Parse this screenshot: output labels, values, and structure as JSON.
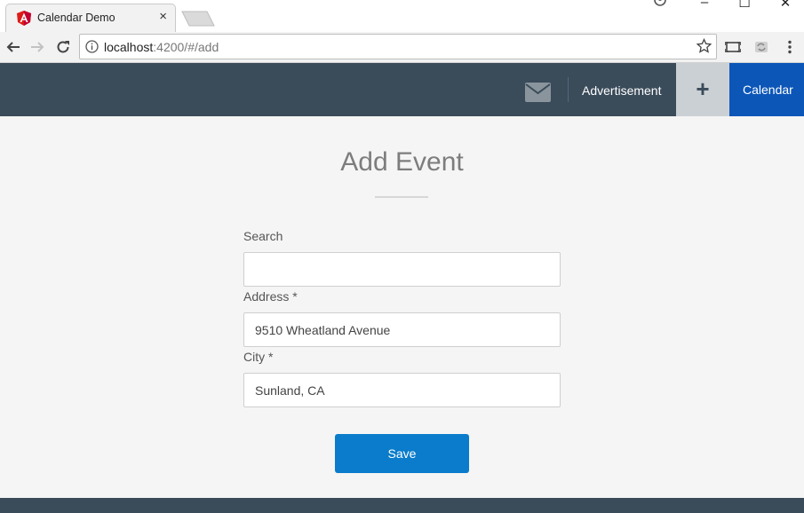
{
  "browser": {
    "tab_title": "Calendar Demo",
    "tab_close": "×",
    "url_host": "localhost",
    "url_rest": ":4200/#/add",
    "window_controls": {
      "minimize": "–",
      "maximize": "☐",
      "close": "✕"
    }
  },
  "header": {
    "advertisement_label": "Advertisement",
    "plus_label": "+",
    "calendar_label": "Calendar"
  },
  "form": {
    "title": "Add Event",
    "search": {
      "label": "Search",
      "value": ""
    },
    "address": {
      "label": "Address *",
      "value": "9510 Wheatland Avenue"
    },
    "city": {
      "label": "City *",
      "value": "Sunland, CA"
    },
    "save_label": "Save"
  },
  "colors": {
    "header_bg": "#3a4b5a",
    "calendar_btn": "#0c56b8",
    "save_btn": "#0a7ccb",
    "plus_btn": "#cbd0d4"
  },
  "icons": [
    "angular-icon",
    "back-arrow-icon",
    "forward-arrow-icon",
    "reload-icon",
    "info-icon",
    "star-icon",
    "cast-icon",
    "sync-icon",
    "menu-dots-icon",
    "profile-icon",
    "mail-icon",
    "plus-icon"
  ]
}
